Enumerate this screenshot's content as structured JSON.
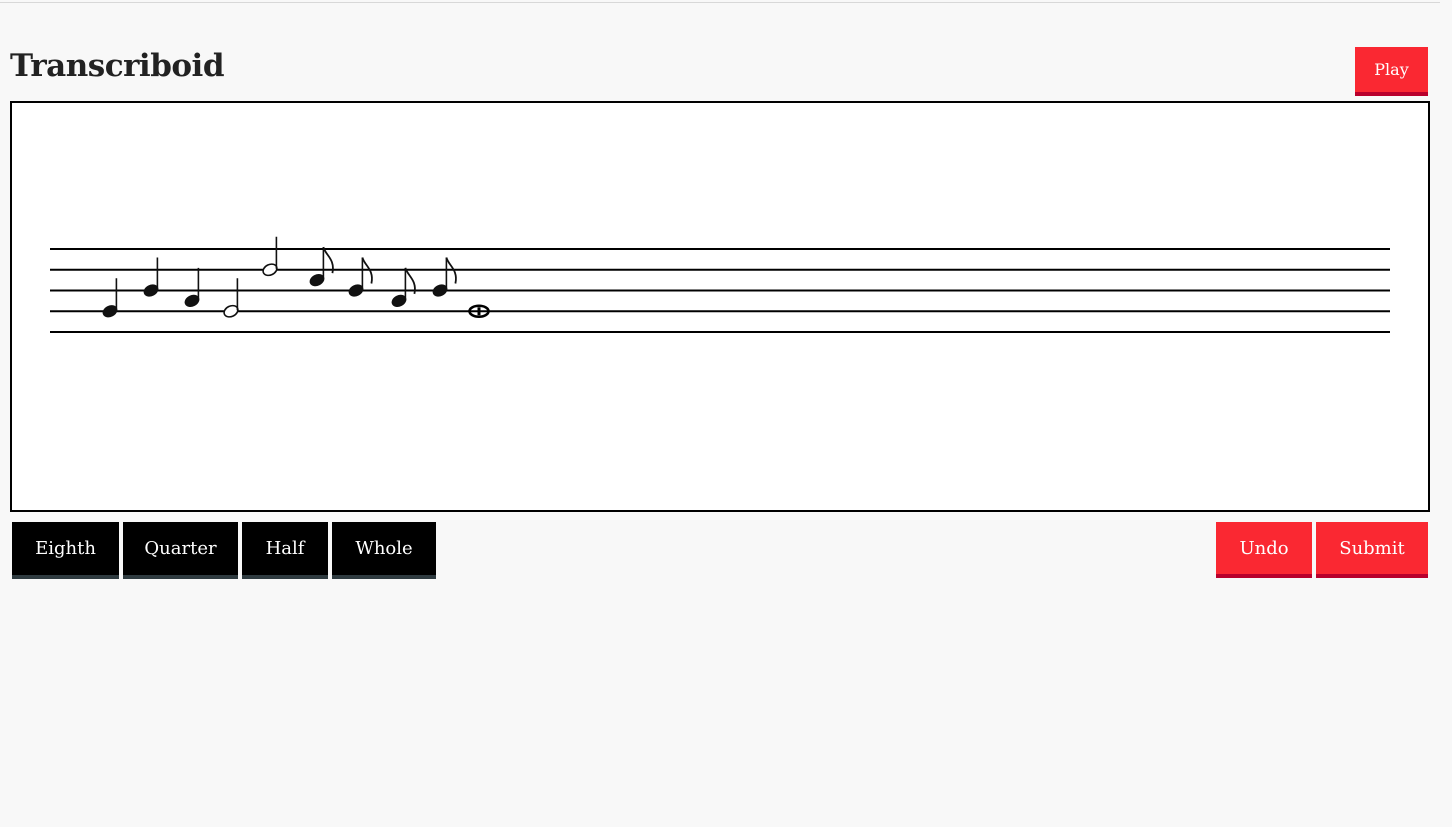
{
  "app": {
    "title": "Transcriboid"
  },
  "header": {
    "play_label": "Play"
  },
  "note_buttons": {
    "eighth": "Eighth",
    "quarter": "Quarter",
    "half": "Half",
    "whole": "Whole"
  },
  "actions": {
    "undo": "Undo",
    "submit": "Submit"
  },
  "colors": {
    "accent_red": "#fa2832",
    "accent_red_shadow": "#b8002c",
    "button_black": "#000000",
    "button_black_shadow": "#2f3b40"
  },
  "staff": {
    "notes": [
      {
        "duration": "quarter",
        "pitch_step": 0
      },
      {
        "duration": "quarter",
        "pitch_step": 2
      },
      {
        "duration": "quarter",
        "pitch_step": 1
      },
      {
        "duration": "half",
        "pitch_step": 0
      },
      {
        "duration": "half",
        "pitch_step": 4
      },
      {
        "duration": "eighth",
        "pitch_step": 3
      },
      {
        "duration": "eighth",
        "pitch_step": 2
      },
      {
        "duration": "eighth",
        "pitch_step": 1
      },
      {
        "duration": "eighth",
        "pitch_step": 2
      },
      {
        "duration": "whole",
        "pitch_step": 0
      }
    ]
  }
}
